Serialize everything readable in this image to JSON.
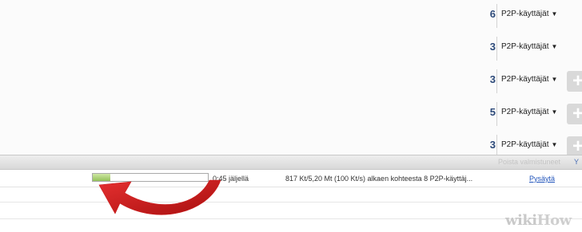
{
  "peers_list": {
    "dropdown_caret": "▼",
    "add_icon": "plus-icon",
    "rows": [
      {
        "count": "6",
        "label": "P2P-käyttäjät"
      },
      {
        "count": "3",
        "label": "P2P-käyttäjät"
      },
      {
        "count": "3",
        "label": "P2P-käyttäjät"
      },
      {
        "count": "5",
        "label": "P2P-käyttäjät"
      },
      {
        "count": "3",
        "label": "P2P-käyttäjät"
      }
    ]
  },
  "toolbar": {
    "hint": "Poista valmistuneet",
    "hint_link": "Y"
  },
  "download": {
    "progress": 0.15,
    "remaining": "0:45 jäljellä",
    "status": "817 Kt/5,20 Mt (100 Kt/s) alkaen kohteesta 8 P2P-käyttäj...",
    "pause_label": "Pysäytä"
  },
  "annotation": {
    "arrow_color": "#cc1b1b",
    "arrow_icon": "curved-arrow-icon"
  },
  "watermark": {
    "part1": "wiki",
    "part2": "How"
  }
}
